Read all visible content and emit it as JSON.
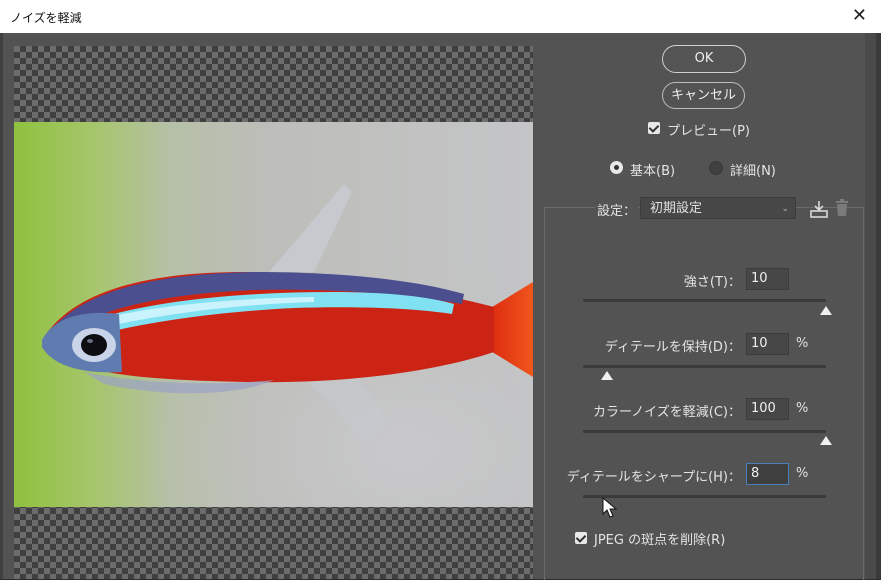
{
  "window": {
    "title": "ノイズを軽減",
    "close_glyph": "✕"
  },
  "buttons": {
    "ok": "OK",
    "cancel": "キャンセル"
  },
  "preview_checkbox": {
    "label": "プレビュー(P)",
    "checked": true
  },
  "mode": {
    "basic": "基本(B)",
    "advanced": "詳細(N)",
    "selected": "basic"
  },
  "settings": {
    "label": "設定：",
    "value": "初期設定",
    "save_icon": "save-preset-icon",
    "delete_icon": "trash-icon"
  },
  "sliders": [
    {
      "label": "強さ(T)：",
      "value": "10",
      "unit": "",
      "fraction": 1.0
    },
    {
      "label": "ディテールを保持(D)：",
      "value": "10",
      "unit": "%",
      "fraction": 0.1
    },
    {
      "label": "カラーノイズを軽減(C)：",
      "value": "100",
      "unit": "%",
      "fraction": 1.0
    },
    {
      "label": "ディテールをシャープに(H)：",
      "value": "8",
      "unit": "%",
      "fraction": 0.08
    }
  ],
  "jpeg_checkbox": {
    "label": "JPEG の斑点を削除(R)",
    "checked": true
  },
  "colors": {
    "dialog_bg": "#535353",
    "accent_focus": "#4a7fbf"
  }
}
